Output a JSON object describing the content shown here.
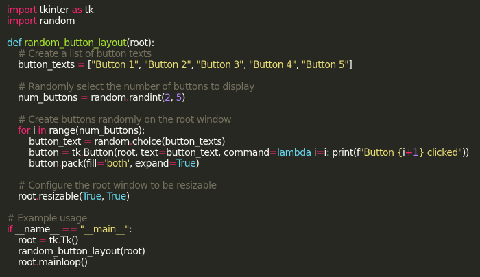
{
  "editor": {
    "language": "python",
    "theme_colors": {
      "background": "#272822",
      "text": "#f8f8f2",
      "keyword": "#f92672",
      "function": "#a6e22e",
      "comment": "#75715e",
      "string": "#e6db74",
      "number": "#ae81ff",
      "constant": "#66d9ef"
    },
    "lines": [
      [
        [
          "kw",
          "import"
        ],
        [
          "ws",
          " "
        ],
        [
          "name",
          "tkinter"
        ],
        [
          "ws",
          " "
        ],
        [
          "kw",
          "as"
        ],
        [
          "ws",
          " "
        ],
        [
          "name",
          "tk"
        ]
      ],
      [
        [
          "kw",
          "import"
        ],
        [
          "ws",
          " "
        ],
        [
          "name",
          "random"
        ]
      ],
      [],
      [
        [
          "const",
          "def"
        ],
        [
          "ws",
          " "
        ],
        [
          "fn",
          "random_button_layout"
        ],
        [
          "punc",
          "(root):"
        ]
      ],
      [
        [
          "ws",
          "    "
        ],
        [
          "comment",
          "# Create a list of button texts"
        ]
      ],
      [
        [
          "ws",
          "    "
        ],
        [
          "name",
          "button_texts"
        ],
        [
          "ws",
          " "
        ],
        [
          "op",
          "="
        ],
        [
          "ws",
          " "
        ],
        [
          "punc",
          "["
        ],
        [
          "str",
          "\"Button 1\""
        ],
        [
          "punc",
          ", "
        ],
        [
          "str",
          "\"Button 2\""
        ],
        [
          "punc",
          ", "
        ],
        [
          "str",
          "\"Button 3\""
        ],
        [
          "punc",
          ", "
        ],
        [
          "str",
          "\"Button 4\""
        ],
        [
          "punc",
          ", "
        ],
        [
          "str",
          "\"Button 5\""
        ],
        [
          "punc",
          "]"
        ]
      ],
      [],
      [
        [
          "ws",
          "    "
        ],
        [
          "comment",
          "# Randomly select the number of buttons to display"
        ]
      ],
      [
        [
          "ws",
          "    "
        ],
        [
          "name",
          "num_buttons"
        ],
        [
          "ws",
          " "
        ],
        [
          "op",
          "="
        ],
        [
          "ws",
          " "
        ],
        [
          "name",
          "random"
        ],
        [
          "op",
          "."
        ],
        [
          "name",
          "randint"
        ],
        [
          "punc",
          "("
        ],
        [
          "num",
          "2"
        ],
        [
          "punc",
          ", "
        ],
        [
          "num",
          "5"
        ],
        [
          "punc",
          ")"
        ]
      ],
      [],
      [
        [
          "ws",
          "    "
        ],
        [
          "comment",
          "# Create buttons randomly on the root window"
        ]
      ],
      [
        [
          "ws",
          "    "
        ],
        [
          "kw",
          "for"
        ],
        [
          "ws",
          " "
        ],
        [
          "name",
          "i"
        ],
        [
          "ws",
          " "
        ],
        [
          "kw",
          "in"
        ],
        [
          "ws",
          " "
        ],
        [
          "builtin",
          "range"
        ],
        [
          "punc",
          "(num_buttons):"
        ]
      ],
      [
        [
          "ws",
          "        "
        ],
        [
          "name",
          "button_text"
        ],
        [
          "ws",
          " "
        ],
        [
          "op",
          "="
        ],
        [
          "ws",
          " "
        ],
        [
          "name",
          "random"
        ],
        [
          "op",
          "."
        ],
        [
          "name",
          "choice"
        ],
        [
          "punc",
          "(button_texts)"
        ]
      ],
      [
        [
          "ws",
          "        "
        ],
        [
          "name",
          "button"
        ],
        [
          "ws",
          " "
        ],
        [
          "op",
          "="
        ],
        [
          "ws",
          " "
        ],
        [
          "name",
          "tk"
        ],
        [
          "op",
          "."
        ],
        [
          "name",
          "Button"
        ],
        [
          "punc",
          "(root, text"
        ],
        [
          "op",
          "="
        ],
        [
          "name",
          "button_text"
        ],
        [
          "punc",
          ", command"
        ],
        [
          "op",
          "="
        ],
        [
          "const",
          "lambda"
        ],
        [
          "ws",
          " "
        ],
        [
          "name",
          "i"
        ],
        [
          "op",
          "="
        ],
        [
          "name",
          "i"
        ],
        [
          "punc",
          ": print(f"
        ],
        [
          "str",
          "\"Button {"
        ],
        [
          "name",
          "i"
        ],
        [
          "op",
          "+"
        ],
        [
          "num",
          "1"
        ],
        [
          "str",
          "} clicked\""
        ],
        [
          "punc",
          "))"
        ]
      ],
      [
        [
          "ws",
          "        "
        ],
        [
          "name",
          "button"
        ],
        [
          "op",
          "."
        ],
        [
          "name",
          "pack"
        ],
        [
          "punc",
          "(fill"
        ],
        [
          "op",
          "="
        ],
        [
          "str",
          "'both'"
        ],
        [
          "punc",
          ", expand"
        ],
        [
          "op",
          "="
        ],
        [
          "const",
          "True"
        ],
        [
          "punc",
          ")"
        ]
      ],
      [],
      [
        [
          "ws",
          "    "
        ],
        [
          "comment",
          "# Configure the root window to be resizable"
        ]
      ],
      [
        [
          "ws",
          "    "
        ],
        [
          "name",
          "root"
        ],
        [
          "op",
          "."
        ],
        [
          "name",
          "resizable"
        ],
        [
          "punc",
          "("
        ],
        [
          "const",
          "True"
        ],
        [
          "punc",
          ", "
        ],
        [
          "const",
          "True"
        ],
        [
          "punc",
          ")"
        ]
      ],
      [],
      [
        [
          "comment",
          "# Example usage"
        ]
      ],
      [
        [
          "kw",
          "if"
        ],
        [
          "ws",
          " "
        ],
        [
          "name",
          "__name__"
        ],
        [
          "ws",
          " "
        ],
        [
          "op",
          "=="
        ],
        [
          "ws",
          " "
        ],
        [
          "str",
          "\"__main__\""
        ],
        [
          "punc",
          ":"
        ]
      ],
      [
        [
          "ws",
          "    "
        ],
        [
          "name",
          "root"
        ],
        [
          "ws",
          " "
        ],
        [
          "op",
          "="
        ],
        [
          "ws",
          " "
        ],
        [
          "name",
          "tk"
        ],
        [
          "op",
          "."
        ],
        [
          "name",
          "Tk"
        ],
        [
          "punc",
          "()"
        ]
      ],
      [
        [
          "ws",
          "    "
        ],
        [
          "name",
          "random_button_layout"
        ],
        [
          "punc",
          "(root)"
        ]
      ],
      [
        [
          "ws",
          "    "
        ],
        [
          "name",
          "root"
        ],
        [
          "op",
          "."
        ],
        [
          "name",
          "mainloop"
        ],
        [
          "punc",
          "()"
        ]
      ]
    ]
  }
}
